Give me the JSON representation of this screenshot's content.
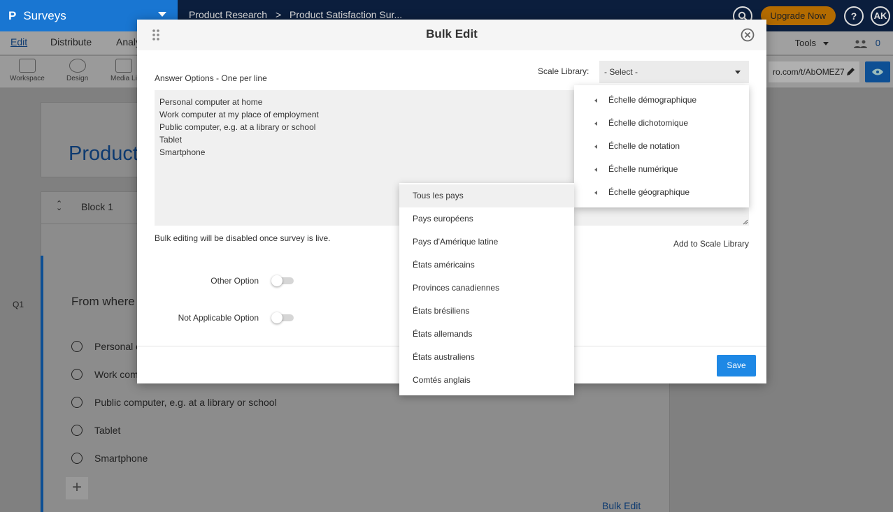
{
  "app": {
    "name": "Surveys",
    "logo_letter": "P",
    "breadcrumb": [
      "Product Research",
      "Product Satisfaction Sur..."
    ],
    "upgrade_label": "Upgrade Now",
    "help_label": "?",
    "avatar_initials": "AK",
    "tabs": [
      "Edit",
      "Distribute",
      "Analy"
    ],
    "tools_label": "Tools",
    "collaborator_count": "0",
    "toolbar": [
      "Workspace",
      "Design",
      "Media Li"
    ],
    "share_url": "ro.com/t/AbOMEZ7"
  },
  "survey": {
    "title": "Product",
    "block_label": "Block 1",
    "question_number": "Q1",
    "question_text": "From where",
    "options": [
      "Personal c",
      "Work com",
      "Public computer, e.g. at a library or school",
      "Tablet",
      "Smartphone"
    ],
    "bulk_edit_link": "Bulk Edit"
  },
  "modal": {
    "title": "Bulk Edit",
    "answers_label": "Answer Options - One per line",
    "answers_text": "Personal computer at home\nWork computer at my place of employment\nPublic computer, e.g. at a library or school\nTablet\nSmartphone",
    "scale_library_label": "Scale Library:",
    "scale_select_value": "- Select -",
    "disabled_note": "Bulk editing will be disabled once survey is live.",
    "add_to_library": "Add to Scale Library",
    "other_option_label": "Other Option",
    "not_applicable_label": "Not Applicable Option",
    "save_label": "Save"
  },
  "scale_menu": [
    "Échelle démographique",
    "Échelle dichotomique",
    "Échelle de notation",
    "Échelle numérique",
    "Échelle géographique"
  ],
  "sub_menu": [
    "Tous les pays",
    "Pays européens",
    "Pays d'Amérique latine",
    "États américains",
    "Provinces canadiennes",
    "États brésiliens",
    "États allemands",
    "États australiens",
    "Comtés anglais"
  ],
  "colors": {
    "primary": "#1e88e5",
    "brand_blue": "#1976d2",
    "top_bar": "#0b1e3d",
    "upgrade": "#f5a623"
  }
}
